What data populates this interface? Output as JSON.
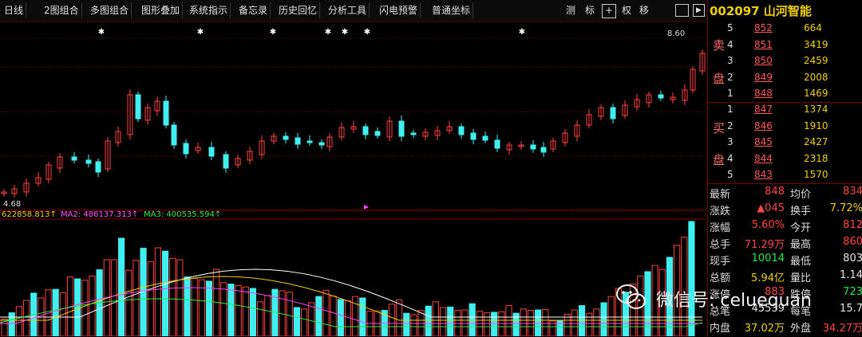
{
  "toolbar": {
    "items": [
      "日线",
      "2图组合",
      "多图组合",
      "图形叠加",
      "系统指示",
      "备忘录",
      "历史回忆",
      "分析工具",
      "闪电预警",
      "普通坐标"
    ],
    "right_items": [
      "测",
      "标",
      "权",
      "移"
    ]
  },
  "quote": {
    "code": "002097",
    "name": "山河智能",
    "sell_label": [
      "卖",
      "盘"
    ],
    "buy_label": [
      "买",
      "盘"
    ],
    "asks": [
      {
        "level": "5",
        "price": "852",
        "volume": "664"
      },
      {
        "level": "4",
        "price": "851",
        "volume": "3419"
      },
      {
        "level": "3",
        "price": "850",
        "volume": "2459"
      },
      {
        "level": "2",
        "price": "849",
        "volume": "2008"
      },
      {
        "level": "1",
        "price": "848",
        "volume": "1469"
      }
    ],
    "bids": [
      {
        "level": "1",
        "price": "847",
        "volume": "1374"
      },
      {
        "level": "2",
        "price": "846",
        "volume": "1910"
      },
      {
        "level": "3",
        "price": "845",
        "volume": "2427"
      },
      {
        "level": "4",
        "price": "844",
        "volume": "2318"
      },
      {
        "level": "5",
        "price": "843",
        "volume": "1570"
      }
    ],
    "stats": [
      {
        "k": "最新",
        "v": "848",
        "k2": "均价",
        "v2": "834"
      },
      {
        "k": "涨跌",
        "v": "▲045",
        "k2": "换手",
        "v2": "7.72%"
      },
      {
        "k": "涨幅",
        "v": "5.60%",
        "k2": "今开",
        "v2": "812"
      },
      {
        "k": "总手",
        "v": "71.29万",
        "k2": "最高",
        "v2": "860"
      },
      {
        "k": "现手",
        "v": "10014",
        "k2": "最低",
        "v2": "803"
      },
      {
        "k": "总额",
        "v": "5.94亿",
        "k2": "量比",
        "v2": "1.14"
      },
      {
        "k": "涨停",
        "v": "883",
        "k2": "跌停",
        "v2": "723"
      },
      {
        "k": "总笔",
        "v": "45539",
        "k2": "每笔",
        "v2": "15.7"
      },
      {
        "k": "内盘",
        "v": "37.02万",
        "k2": "外盘",
        "v2": "34.27万"
      }
    ]
  },
  "chart": {
    "high_label": "8.60",
    "low_label": "4.68",
    "ma_line": [
      {
        "text": "622858.813↑",
        "color": "#f0d000"
      },
      {
        "text": "MA2: 486137.313↑",
        "color": "#ff55ff"
      },
      {
        "text": "MA3: 400535.594↑",
        "color": "#22ee44"
      }
    ]
  },
  "watermark": "微信号: celuequan",
  "colors": {
    "up": "#ff4040",
    "down": "#40f0f0",
    "ma1": "#ffffff",
    "ma2": "#f0d000",
    "ma3": "#ff40ff",
    "ma4": "#22ee44"
  }
}
